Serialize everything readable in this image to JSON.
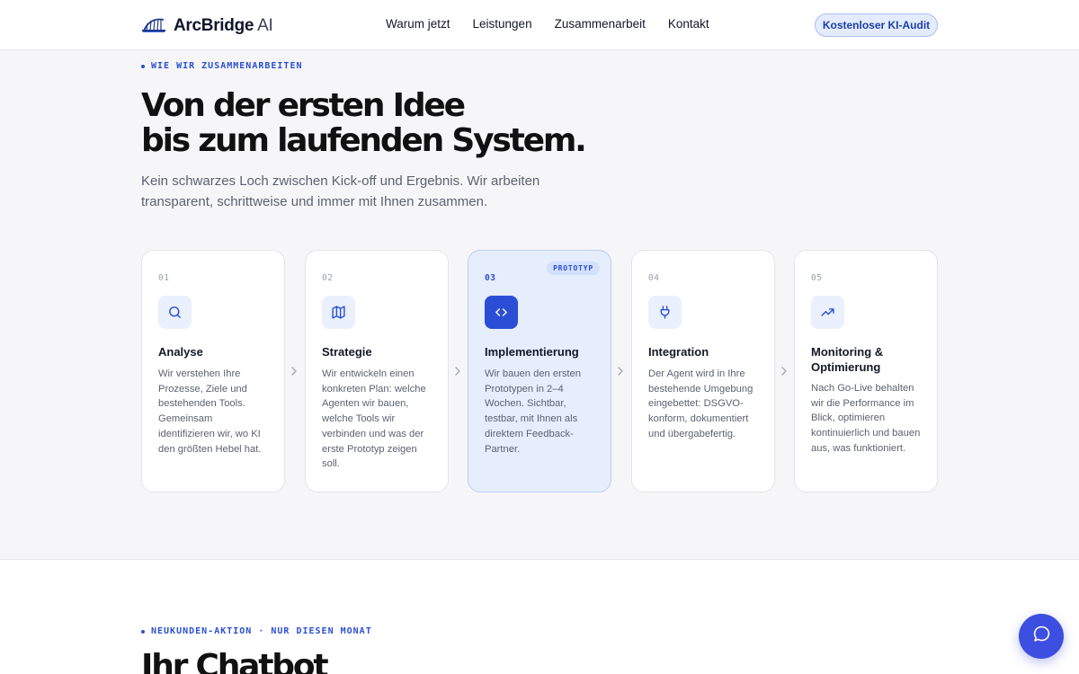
{
  "header": {
    "logo_brand": "ArcBridge",
    "logo_suffix": "AI",
    "logo_icon": "bridge-icon",
    "nav": [
      "Warum jetzt",
      "Leistungen",
      "Zusammenarbeit",
      "Kontakt"
    ],
    "cta_label": "Kostenloser KI-Audit"
  },
  "process": {
    "eyebrow": "WIE WIR ZUSAMMENARBEITEN",
    "headline_line1": "Von der ersten Idee",
    "headline_line2": "bis zum laufenden System.",
    "lead": "Kein schwarzes Loch zwischen Kick-off und Ergebnis. Wir arbeiten transparent, schrittweise und immer mit Ihnen zusammen.",
    "steps": [
      {
        "num": "01",
        "icon": "search-icon",
        "title": "Analyse",
        "desc": "Wir verstehen Ihre Prozesse, Ziele und bestehenden Tools. Gemeinsam identifizieren wir, wo KI den größten Hebel hat."
      },
      {
        "num": "02",
        "icon": "map-icon",
        "title": "Strategie",
        "desc": "Wir entwickeln einen konkreten Plan: welche Agenten wir bauen, welche Tools wir verbinden und was der erste Prototyp zeigen soll."
      },
      {
        "num": "03",
        "icon": "code-icon",
        "title": "Implementierung",
        "badge": "PROTOTYP",
        "desc": "Wir bauen den ersten Prototypen in 2–4 Wochen. Sichtbar, testbar, mit Ihnen als direktem Feedback-Partner."
      },
      {
        "num": "04",
        "icon": "plug-icon",
        "title": "Integration",
        "desc": "Der Agent wird in Ihre bestehende Umgebung eingebettet: DSGVO-konform, dokumentiert und übergabefertig."
      },
      {
        "num": "05",
        "icon": "trending-up-icon",
        "title": "Monitoring & Optimierung",
        "desc": "Nach Go-Live behalten wir die Performance im Blick, optimieren kontinuierlich und bauen aus, was funktioniert."
      }
    ]
  },
  "offer": {
    "eyebrow": "NEUKUNDEN-AKTION · NUR DIESEN MONAT",
    "headline": "Ihr Chatbot"
  },
  "chat": {
    "icon": "chat-bubble-icon"
  },
  "colors": {
    "accent": "#2a4fd6",
    "fab": "#3d4fe0",
    "section_bg": "#f6f6f8"
  }
}
